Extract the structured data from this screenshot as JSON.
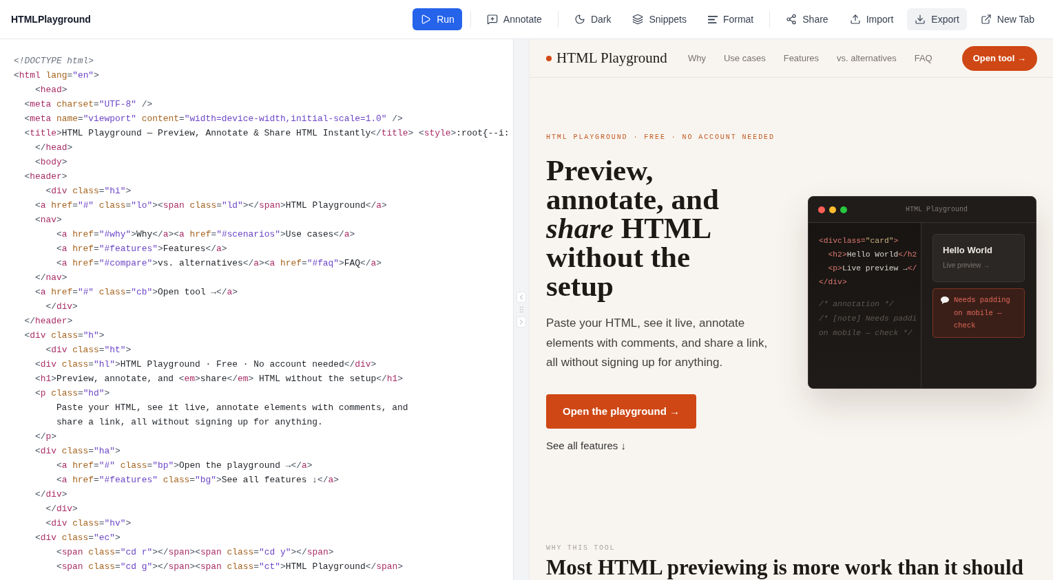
{
  "toolbar": {
    "logo": "HTMLPlayground",
    "groups": [
      {
        "buttons": [
          {
            "label": "Run",
            "kind": "primary",
            "hovered": false
          }
        ]
      },
      {
        "buttons": [
          {
            "label": "Annotate",
            "kind": "plain",
            "hovered": false
          }
        ]
      },
      {
        "buttons": [
          {
            "label": "Dark",
            "kind": "plain",
            "hovered": false
          },
          {
            "label": "Snippets",
            "kind": "plain",
            "hovered": false
          },
          {
            "label": "Format",
            "kind": "plain",
            "hovered": false
          }
        ]
      },
      {
        "buttons": [
          {
            "label": "Share",
            "kind": "plain",
            "hovered": false
          },
          {
            "label": "Import",
            "kind": "plain",
            "hovered": false
          },
          {
            "label": "Export",
            "kind": "plain",
            "hovered": true
          },
          {
            "label": "New Tab",
            "kind": "plain",
            "hovered": false
          }
        ]
      }
    ]
  },
  "editor": {
    "lines": [
      "<!DOCTYPE html>",
      "<html lang=\"en\">",
      "    <head>",
      "  <meta charset=\"UTF-8\" />",
      "  <meta name=\"viewport\" content=\"width=device-width,initial-scale=1.0\" />",
      "  <title>HTML Playground — Preview, Annotate & Share HTML Instantly</title> <style>:root{--i:",
      "    </head>",
      "    <body>",
      "  <header>",
      "      <div class=\"hi\">",
      "    <a href=\"#\" class=\"lo\"><span class=\"ld\"></span>HTML Playground</a>",
      "    <nav>",
      "        <a href=\"#why\">Why</a><a href=\"#scenarios\">Use cases</a>",
      "        <a href=\"#features\">Features</a>",
      "        <a href=\"#compare\">vs. alternatives</a><a href=\"#faq\">FAQ</a>",
      "    </nav>",
      "    <a href=\"#\" class=\"cb\">Open tool →</a>",
      "      </div>",
      "  </header>",
      "  <div class=\"h\">",
      "      <div class=\"ht\">",
      "    <div class=\"hl\">HTML Playground · Free · No account needed</div>",
      "    <h1>Preview, annotate, and <em>share</em> HTML without the setup</h1>",
      "    <p class=\"hd\">",
      "        Paste your HTML, see it live, annotate elements with comments, and",
      "        share a link, all without signing up for anything.",
      "    </p>",
      "    <div class=\"ha\">",
      "        <a href=\"#\" class=\"bp\">Open the playground →</a>",
      "        <a href=\"#features\" class=\"bg\">See all features ↓</a>",
      "    </div>",
      "      </div>",
      "      <div class=\"hv\">",
      "    <div class=\"ec\">",
      "        <span class=\"cd r\"></span><span class=\"cd y\"></span>",
      "        <span class=\"cd g\"></span><span class=\"ct\">HTML Playground</span>"
    ]
  },
  "preview": {
    "nav": {
      "brand": "HTML Playground",
      "links": [
        "Why",
        "Use cases",
        "Features",
        "vs. alternatives",
        "FAQ"
      ],
      "cta": "Open tool →"
    },
    "hero": {
      "eyebrow": "HTML PLAYGROUND · FREE · NO ACCOUNT NEEDED",
      "title": "Preview, annotate, and *share* HTML without the setup",
      "lead": "Paste your HTML, see it live, annotate elements with comments, and share a link, all without signing up for anything.",
      "primary_button": "Open the playground →",
      "secondary_link": "See all features ↓"
    },
    "mockup": {
      "title": "HTML Playground",
      "code_lines": [
        "<divclass=\"card\">",
        "  <h2>Hello World</h2",
        "  <p>Live preview →</",
        "</div>"
      ],
      "comment_lines": [
        "/* annotation */",
        "/* [note] Needs paddi",
        "on mobile — check */"
      ],
      "card": {
        "title": "Hello World",
        "subtitle": "Live preview →"
      },
      "annotation": "Needs padding on mobile — check"
    },
    "section": {
      "eyebrow": "WHY THIS TOOL",
      "heading": "Most HTML previewing is more work than it should"
    }
  }
}
